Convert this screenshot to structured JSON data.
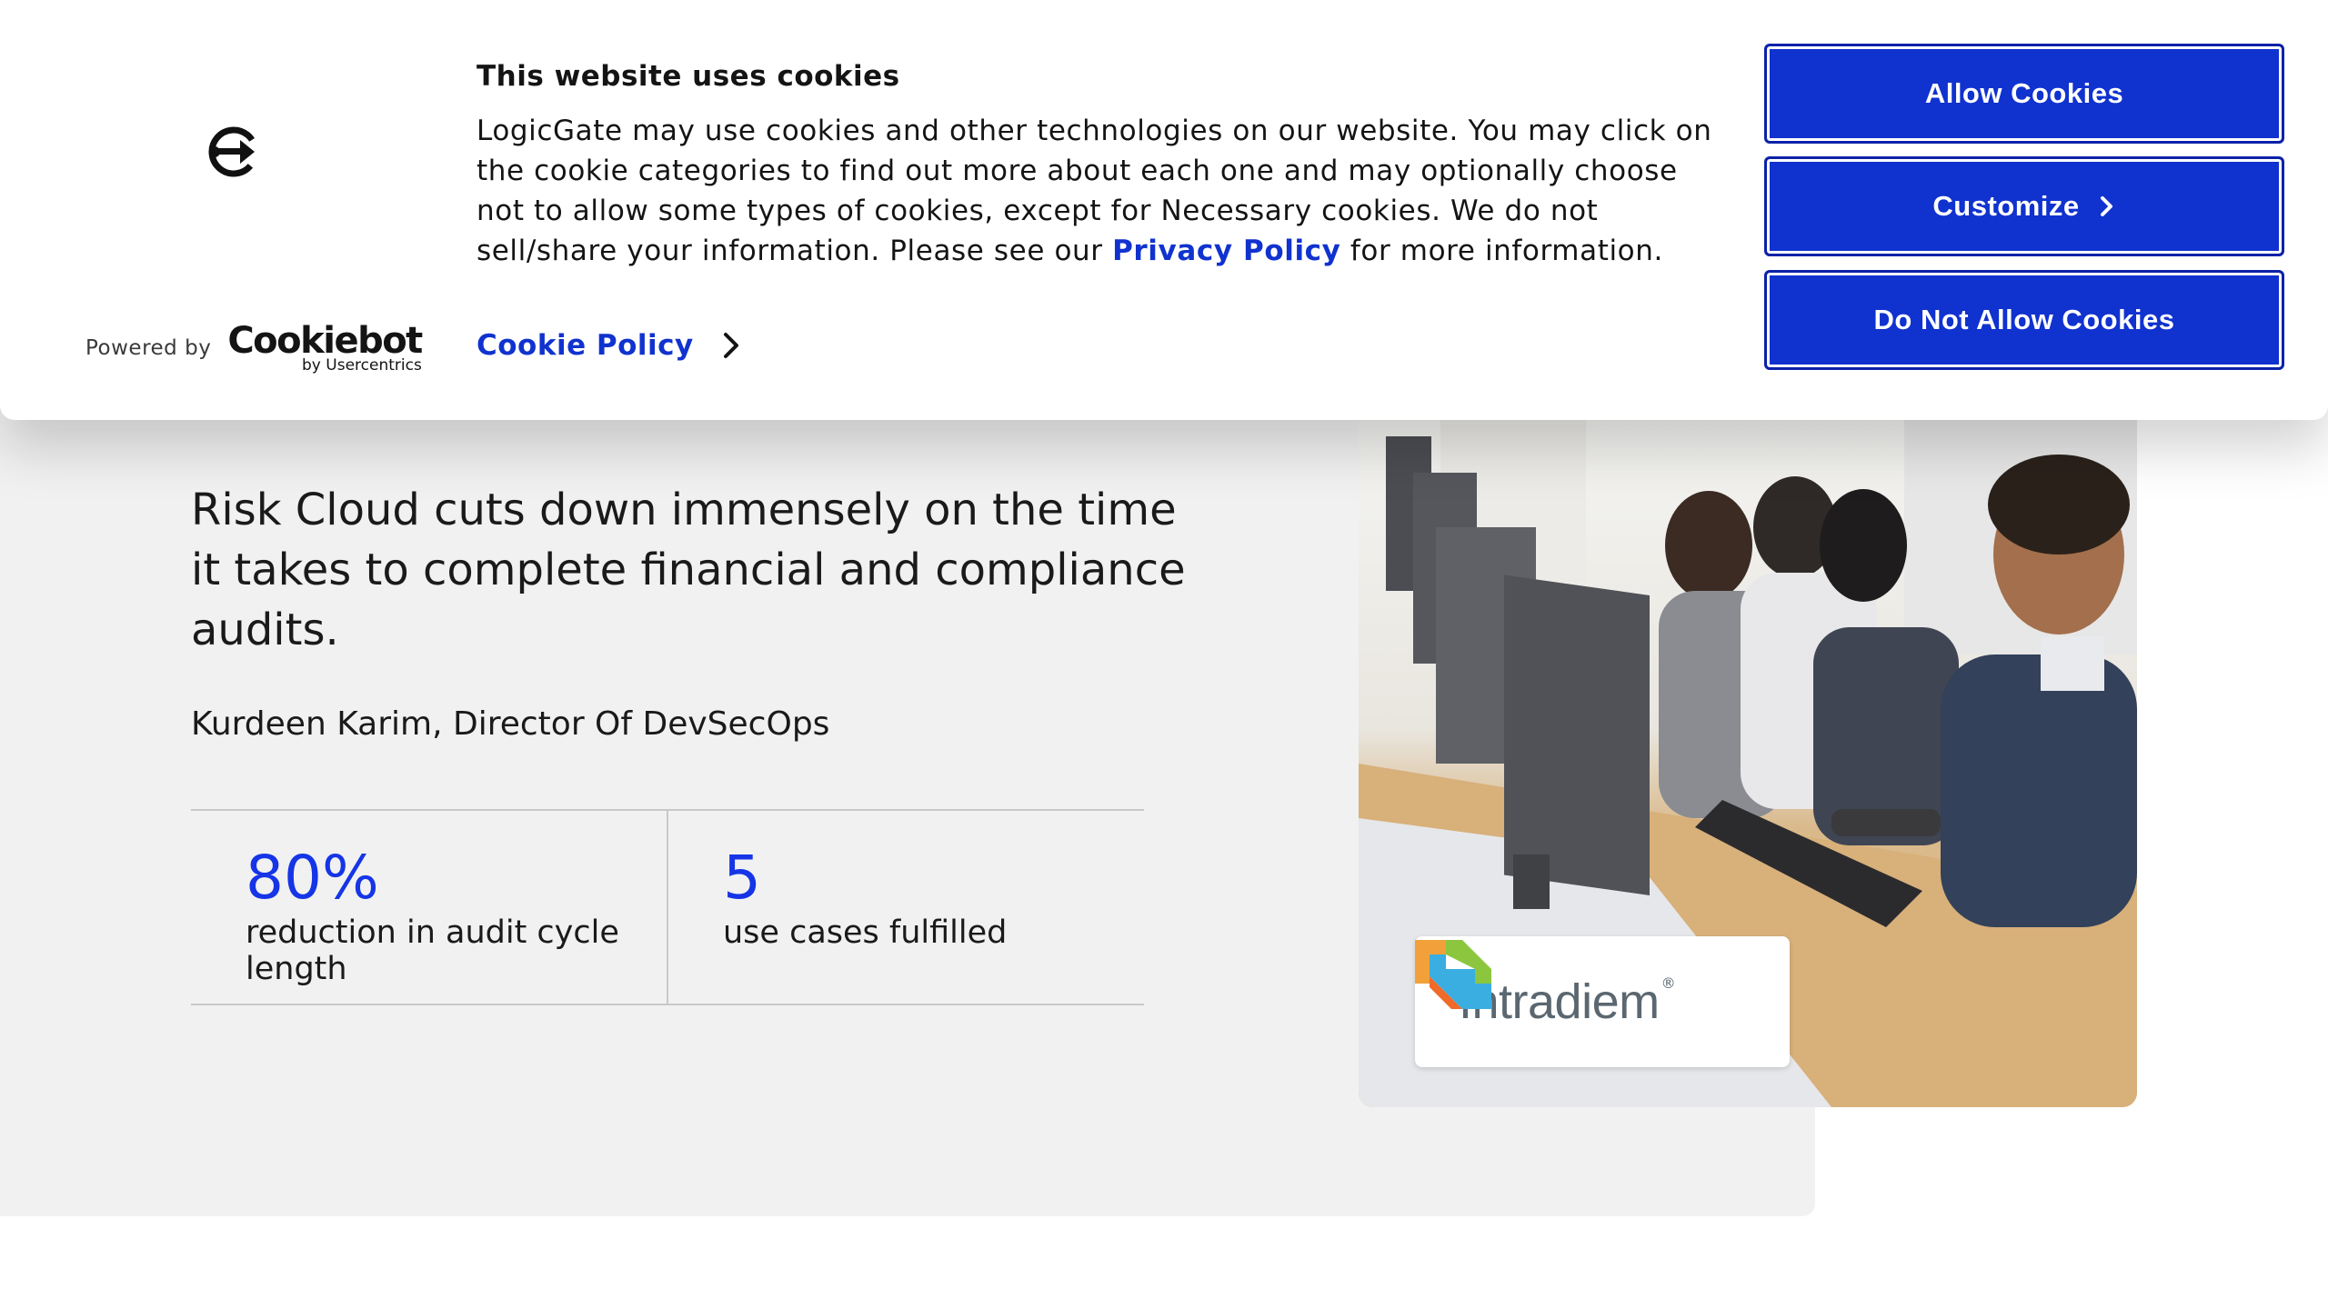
{
  "cookie_banner": {
    "title": "This website uses cookies",
    "body_text": "LogicGate may use cookies and other technologies on our website. You may click on the cookie categories to find out more about each one and may optionally choose not to allow some types of cookies, except for Necessary cookies.  We do not sell/share your information. Please see our ",
    "privacy_link": "Privacy Policy",
    "body_suffix": " for more information.",
    "cookie_policy_link": "Cookie Policy",
    "powered_by": "Powered by",
    "cookiebot_wordmark": "Cookiebot",
    "cookiebot_sub": "by Usercentrics",
    "buttons": {
      "allow": "Allow Cookies",
      "customize": "Customize",
      "deny": "Do Not Allow Cookies"
    },
    "accent_color": "#1032cf"
  },
  "case_study": {
    "quote": "Risk Cloud cuts down immensely on the time it takes to complete financial and compliance audits.",
    "author": "Kurdeen Karim, Director Of DevSecOps",
    "stats": [
      {
        "value": "80%",
        "label": "reduction in audit cycle length"
      },
      {
        "value": "5",
        "label": "use cases fulfilled"
      }
    ],
    "customer_logo": "Intradiem",
    "stat_color": "#1535e6"
  }
}
